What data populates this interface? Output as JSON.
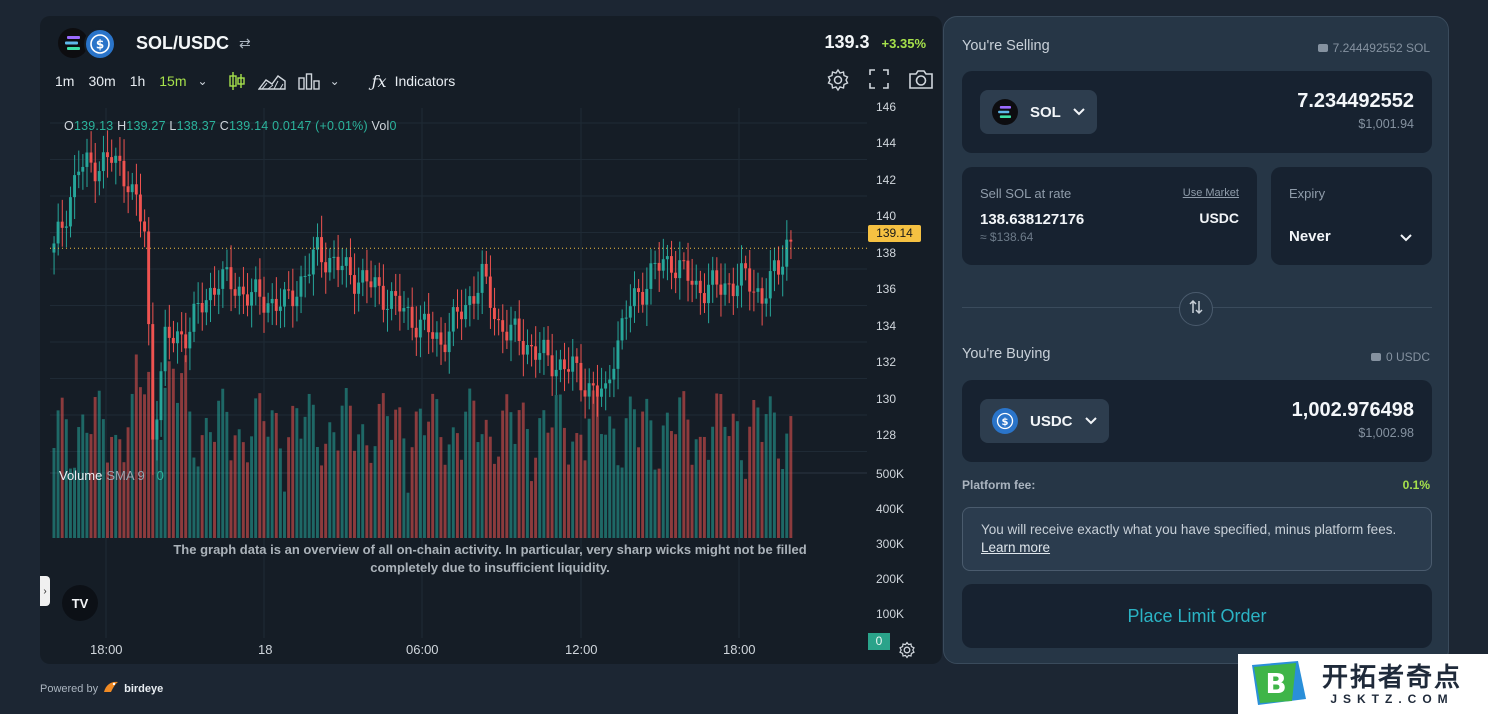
{
  "pair": {
    "name": "SOL/USDC",
    "last_price": "139.3",
    "change": "+3.35%"
  },
  "toolbar": {
    "timeframes": [
      "1m",
      "30m",
      "1h",
      "15m"
    ],
    "active_timeframe": "15m",
    "indicators_label": "Indicators"
  },
  "ohlc": {
    "o_label": "O",
    "o": "139.13",
    "h_label": "H",
    "h": "139.27",
    "l_label": "L",
    "l": "138.37",
    "c_label": "C",
    "c": "139.14",
    "chg": "0.0147 (+0.01%)",
    "vol_label": "Vol",
    "vol": "0"
  },
  "price_axis": {
    "ticks": [
      "146",
      "144",
      "142",
      "140",
      "138",
      "136",
      "134",
      "132",
      "130",
      "128"
    ],
    "last_tag": "139.14"
  },
  "volume_axis": {
    "ticks": [
      "500K",
      "400K",
      "300K",
      "200K",
      "100K"
    ],
    "last_tag": "0"
  },
  "volume_legend": {
    "label": "Volume",
    "sma": "SMA 9",
    "value": "0"
  },
  "time_axis": {
    "labels": [
      "18:00",
      "18",
      "06:00",
      "12:00",
      "18:00"
    ]
  },
  "overlay_note": "The graph data is an overview of all on-chain activity. In particular, very sharp wicks might not be filled completely due to insufficient liquidity.",
  "tv_logo": "TV",
  "powered_by": {
    "label": "Powered by",
    "brand": "birdeye"
  },
  "colors": {
    "up": "#26a69a",
    "down": "#ef5350",
    "accent": "#a6e14b",
    "button_text": "#2bb3c4",
    "last_tag": "#f5c142"
  },
  "swap": {
    "selling_label": "You're Selling",
    "selling_balance": "7.244492552 SOL",
    "sell_token": "SOL",
    "sell_amount": "7.234492552",
    "sell_usd": "$1,001.94",
    "rate_label": "Sell SOL at rate",
    "use_market": "Use Market",
    "rate_value": "138.638127176",
    "rate_usd": "≈ $138.64",
    "rate_unit": "USDC",
    "expiry_label": "Expiry",
    "expiry_value": "Never",
    "buying_label": "You're Buying",
    "buying_balance": "0 USDC",
    "buy_token": "USDC",
    "buy_amount": "1,002.976498",
    "buy_usd": "$1,002.98",
    "fee_label": "Platform fee:",
    "fee_value": "0.1%",
    "info_text": "You will receive exactly what you have specified, minus platform fees.",
    "learn_more": "Learn more",
    "place_button": "Place Limit Order"
  },
  "watermark": {
    "cn": "开拓者奇点",
    "en": "JSKTZ.COM",
    "logo_letter": "B"
  }
}
